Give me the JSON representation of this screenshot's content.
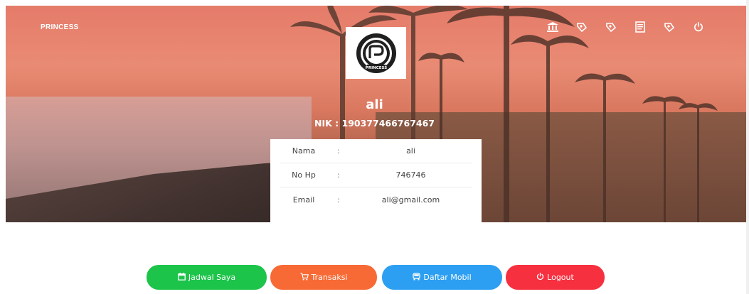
{
  "header": {
    "brand": "PRINCESS",
    "nav_icons": [
      "bank-icon",
      "money-icon",
      "money-icon",
      "receipt-icon",
      "money-icon",
      "power-icon"
    ]
  },
  "logo": {
    "alt_icon": "princess-logo",
    "ring_text": "PRINCESS"
  },
  "profile": {
    "name": "ali",
    "nik": "NIK : 190377466767467"
  },
  "info": {
    "rows": [
      {
        "label": "Nama",
        "sep": ":",
        "value": "ali"
      },
      {
        "label": "No Hp",
        "sep": ":",
        "value": "746746"
      },
      {
        "label": "Email",
        "sep": ":",
        "value": "ali@gmail.com"
      }
    ]
  },
  "actions": {
    "jadwal": {
      "label": "Jadwal Saya",
      "icon": "calendar-icon",
      "color": "#1cc44a"
    },
    "transaksi": {
      "label": "Transaksi",
      "icon": "cart-icon",
      "color": "#f76a35"
    },
    "mobil": {
      "label": "Daftar Mobil",
      "icon": "car-icon",
      "color": "#2d9ff2"
    },
    "logout": {
      "label": "Logout",
      "icon": "power-icon",
      "color": "#f6303f"
    }
  }
}
